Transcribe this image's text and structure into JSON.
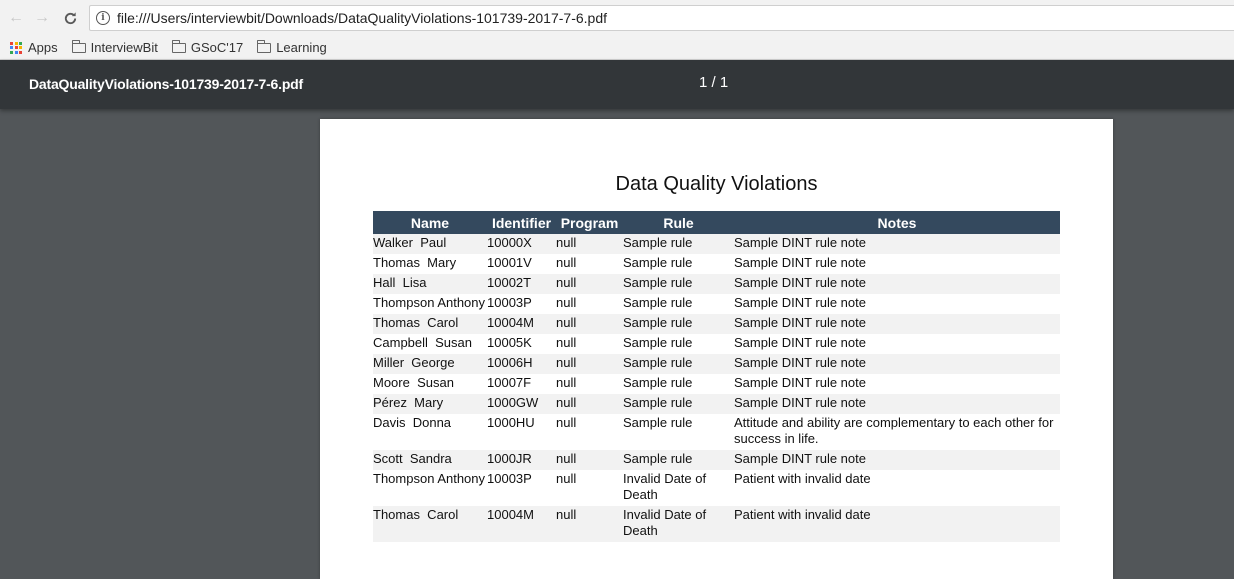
{
  "browser": {
    "url": "file:///Users/interviewbit/Downloads/DataQualityViolations-101739-2017-7-6.pdf",
    "bookmarks": [
      {
        "label": "Apps",
        "icon": "apps-grid-icon"
      },
      {
        "label": "InterviewBit",
        "icon": "folder-icon"
      },
      {
        "label": "GSoC'17",
        "icon": "folder-icon"
      },
      {
        "label": "Learning",
        "icon": "folder-icon"
      }
    ]
  },
  "viewer": {
    "filename": "DataQualityViolations-101739-2017-7-6.pdf",
    "page_indicator": "1 / 1"
  },
  "document": {
    "title": "Data Quality Violations",
    "columns": [
      "Name",
      "Identifier",
      "Program",
      "Rule",
      "Notes"
    ],
    "rows": [
      [
        "Walker  Paul",
        "10000X",
        "null",
        "Sample rule",
        "Sample DINT rule note"
      ],
      [
        "Thomas  Mary",
        "10001V",
        "null",
        "Sample rule",
        "Sample DINT rule note"
      ],
      [
        "Hall  Lisa",
        "10002T",
        "null",
        "Sample rule",
        "Sample DINT rule note"
      ],
      [
        "Thompson Anthony",
        "10003P",
        "null",
        "Sample rule",
        "Sample DINT rule note"
      ],
      [
        "Thomas  Carol",
        "10004M",
        "null",
        "Sample rule",
        "Sample DINT rule note"
      ],
      [
        "Campbell  Susan",
        "10005K",
        "null",
        "Sample rule",
        "Sample DINT rule note"
      ],
      [
        "Miller  George",
        "10006H",
        "null",
        "Sample rule",
        "Sample DINT rule note"
      ],
      [
        "Moore  Susan",
        "10007F",
        "null",
        "Sample rule",
        "Sample DINT rule note"
      ],
      [
        "Pérez  Mary",
        "1000GW",
        "null",
        "Sample rule",
        "Sample DINT rule note"
      ],
      [
        "Davis  Donna",
        "1000HU",
        "null",
        "Sample rule",
        "Attitude and ability are complementary to each other for success in life."
      ],
      [
        "Scott  Sandra",
        "1000JR",
        "null",
        "Sample rule",
        "Sample DINT rule note"
      ],
      [
        "Thompson Anthony",
        "10003P",
        "null",
        "Invalid Date of Death",
        "Patient with invalid date"
      ],
      [
        "Thomas  Carol",
        "10004M",
        "null",
        "Invalid Date of Death",
        "Patient with invalid date"
      ]
    ]
  },
  "colors": {
    "viewer_header": "#323639",
    "viewer_background": "#525659",
    "table_header": "#34495e",
    "row_stripe": "#f2f2f2"
  }
}
